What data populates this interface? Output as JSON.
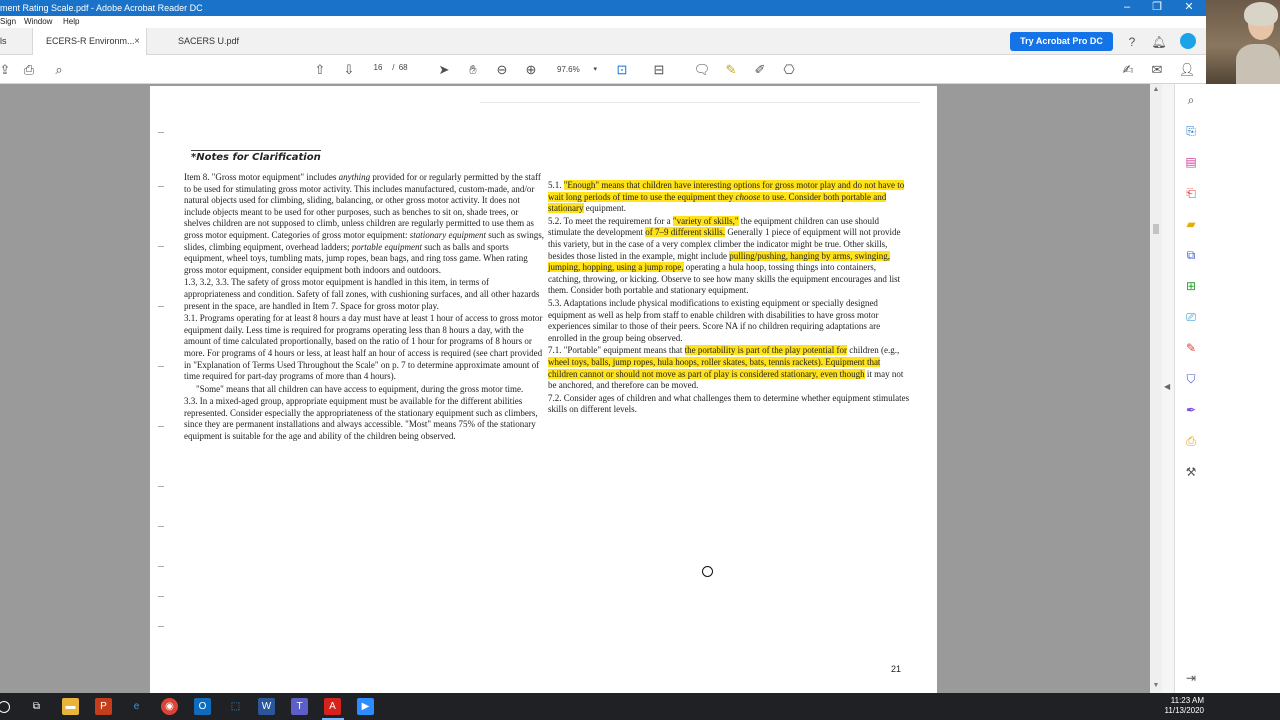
{
  "window": {
    "title": "ment Rating Scale.pdf - Adobe Acrobat Reader DC",
    "minimize": "–",
    "maximize": "❐",
    "close": "✕"
  },
  "menu": {
    "items": [
      "Sign",
      "Window",
      "Help"
    ]
  },
  "tabs": {
    "tools_label": "ls",
    "items": [
      {
        "label": "ECERS-R Environm...",
        "close": "×"
      },
      {
        "label": "SACERS U.pdf"
      }
    ],
    "try_button": "Try Acrobat Pro DC"
  },
  "toolbar": {
    "current_page": "16",
    "page_sep": "/",
    "total_pages": "68",
    "zoom": "97.6%"
  },
  "document": {
    "notes_title": "*Notes for Clarification",
    "left_column": [
      {
        "segments": [
          {
            "t": "Item 8. \"Gross motor equipment\" includes "
          },
          {
            "t": "anything",
            "i": true
          },
          {
            "t": " provided for or regularly permitted by the staff to be used for stimulating gross motor activity. This includes manufactured, custom-made, and/or natural objects used for climbing, sliding, balancing, or other gross motor activity. It does not include objects meant to be used for other purposes, such as benches to sit on, shade trees, or shelves children are not supposed to climb, unless children are regularly permitted to use them as gross motor equipment. Categories of gross motor equipment: "
          },
          {
            "t": "stationary equipment",
            "i": true
          },
          {
            "t": " such as swings, slides, climbing equipment, overhead ladders; "
          },
          {
            "t": "portable equipment",
            "i": true
          },
          {
            "t": " such as balls and sports equipment, wheel toys, tumbling mats, jump ropes, bean bags, and ring toss game. When rating gross motor equipment, consider equipment both indoors and outdoors."
          }
        ]
      },
      {
        "segments": [
          {
            "t": "1.3, 3.2, 3.3. The safety of gross motor equipment is handled in this item, in terms of appropriateness and condition. Safety of fall zones, with cushioning surfaces, and all other hazards present in the space, are handled in Item 7. Space for gross motor play."
          }
        ]
      },
      {
        "segments": [
          {
            "t": "3.1. Programs operating for at least 8 hours a day must have at least 1 hour of access to gross motor equipment daily. Less time is required for programs operating less than 8 hours a day, with the amount of time calculated proportionally, based on the ratio of 1 hour for programs of 8 hours or more. For programs of 4 hours or less, at least half an hour of access is required (see chart provided in \"Explanation of Terms Used Throughout the Scale\" on p. 7 to determine approximate amount of time required for part-day programs of more than 4 hours)."
          }
        ]
      },
      {
        "indent": true,
        "segments": [
          {
            "t": "\"Some\" means that all children can have access to equipment, during the gross motor time."
          }
        ]
      },
      {
        "segments": [
          {
            "t": "3.3. In a mixed-aged group, appropriate equipment must be available for the different abilities represented. Consider especially the appropriateness of the stationary equipment such as climbers, since they are permanent installations and always accessible. \"Most\" means 75% of the stationary equipment is suitable for the age and ability of the children being observed."
          }
        ]
      }
    ],
    "right_column": [
      {
        "segments": [
          {
            "t": "5.1. "
          },
          {
            "t": "\"Enough\" means that children have interesting options for gross motor play and do not have to wait long periods of time to use the equipment they ",
            "h": true
          },
          {
            "t": "choose",
            "h": true,
            "i": true
          },
          {
            "t": " to use. Consider both portable and stationary",
            "h": true
          },
          {
            "t": " equipment."
          }
        ]
      },
      {
        "segments": [
          {
            "t": "5.2. To meet the requirement for a "
          },
          {
            "t": "\"variety of skills,\"",
            "h": true
          },
          {
            "t": " the equipment children can use should stimulate the development "
          },
          {
            "t": "of 7–9 different skills.",
            "h": true
          },
          {
            "t": " Generally 1 piece of equipment will not provide this variety, but in the case of a very complex climber the indicator might be true. Other skills, besides those listed in the example, might include "
          },
          {
            "t": "pulling/pushing, hanging by arms, swinging, jumping, hopping, using a jump rope,",
            "h": true
          },
          {
            "t": " operating a hula hoop, tossing things into containers, catching, throwing, or kicking. Observe to see how many skills the equipment encourages and list them. Consider both portable and stationary equipment."
          }
        ]
      },
      {
        "segments": [
          {
            "t": "5.3. Adaptations include physical modifications to existing equipment or specially designed equipment as well as help from staff to enable children with disabilities to have gross motor experiences similar to those of their peers. Score NA if no children requiring adaptations are enrolled in the group being observed."
          }
        ]
      },
      {
        "segments": [
          {
            "t": "7.1. \"Portable\" equipment means that "
          },
          {
            "t": "the portability is part of the play potential for",
            "h": true
          },
          {
            "t": " children (e.g., "
          },
          {
            "t": "wheel toys, balls, jump ropes, hula hoops, roller skates, bats, tennis rackets). Equipment that children cannot or should not move as part of play is considered stationary, even though",
            "h": true
          },
          {
            "t": " it may not be anchored, and therefore can be moved."
          }
        ]
      },
      {
        "segments": [
          {
            "t": "7.2. Consider ages of children and what challenges them to determine whether equipment stimulates skills on different levels."
          }
        ]
      }
    ],
    "page_number": "21"
  },
  "taskbar": {
    "time": "11:23 AM",
    "date": "11/13/2020"
  },
  "colors": {
    "titlebar": "#1a73c8",
    "highlight": "#ffe21a",
    "try_button": "#1473e6"
  }
}
